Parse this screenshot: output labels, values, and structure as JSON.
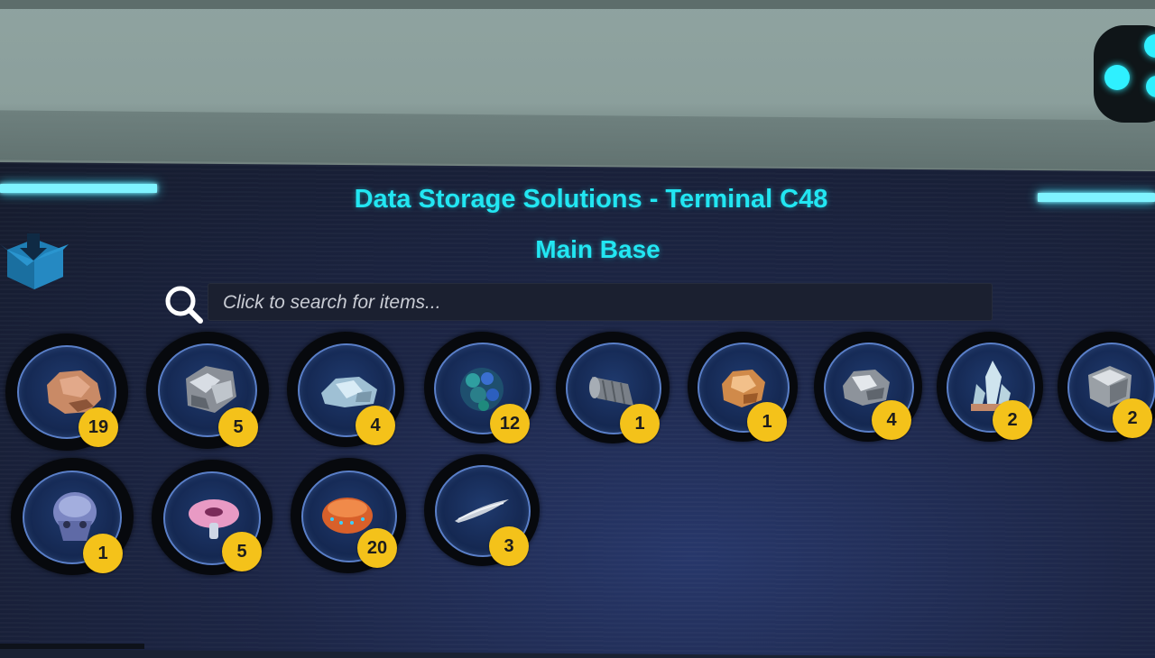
{
  "terminal": {
    "title": "Data Storage Solutions - Terminal C48",
    "location": "Main Base",
    "accent_color": "#22e6f2"
  },
  "search": {
    "placeholder": "Click to search for items...",
    "icon": "magnifier-icon"
  },
  "header_icon": "storage-box-icon",
  "items": [
    {
      "name": "copper-ore",
      "count": "19"
    },
    {
      "name": "titanium-chunk",
      "count": "5"
    },
    {
      "name": "silver-ore",
      "count": "4"
    },
    {
      "name": "blue-crystal-cluster",
      "count": "12"
    },
    {
      "name": "metal-cylinder",
      "count": "1"
    },
    {
      "name": "gold-nugget",
      "count": "1"
    },
    {
      "name": "lead-ore",
      "count": "4"
    },
    {
      "name": "quartz-crystal",
      "count": "2"
    },
    {
      "name": "metal-block",
      "count": "2"
    },
    {
      "name": "alien-skull-fossil",
      "count": "1"
    },
    {
      "name": "pink-mushroom",
      "count": "5"
    },
    {
      "name": "coral-sample",
      "count": "20"
    },
    {
      "name": "tooth-spike",
      "count": "3"
    }
  ]
}
